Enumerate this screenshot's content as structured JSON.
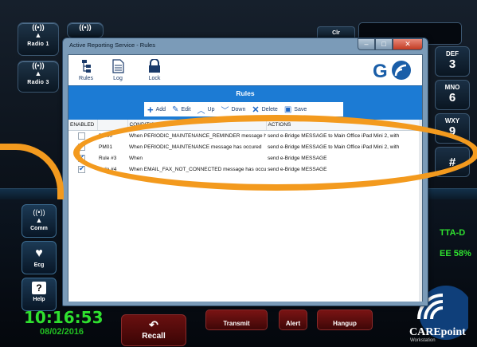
{
  "background": {
    "radio1_label": "Radio 1",
    "radio3_label": "Radio 3",
    "clr_label": "Clr",
    "keypad": [
      {
        "letters": "DEF",
        "num": "3"
      },
      {
        "letters": "MNO",
        "num": "6"
      },
      {
        "letters": "WXY",
        "num": "9"
      },
      {
        "letters": "",
        "num": "#"
      }
    ],
    "side": {
      "comm": "Comm",
      "ecg": "Ecg",
      "help": "Help"
    },
    "clock": "10:16:53",
    "date": "08/02/2016",
    "recall": "Recall",
    "transmit": "Transmit",
    "alert": "Alert",
    "hangup": "Hangup",
    "right_status1": "TTA-D",
    "right_status2": "EE 58%",
    "brand": "CAREpoint",
    "brand_sub": "Workstation"
  },
  "dialog": {
    "title": "Active Reporting Service - Rules",
    "toolbar": {
      "rules": "Rules",
      "log": "Log",
      "lock": "Lock"
    },
    "panel_title": "Rules",
    "actions": {
      "add": "Add",
      "edit": "Edit",
      "up": "Up",
      "down": "Down",
      "delete": "Delete",
      "save": "Save"
    },
    "columns": {
      "enabled": "ENABLED",
      "name": "",
      "conditions": "CONDITIONS",
      "actions": "ACTIONS"
    },
    "rows": [
      {
        "enabled": false,
        "name": "PM00",
        "conditions": "When PERIODIC_MAINTENANCE_REMINDER message h",
        "actions": "send e-Bridge MESSAGE to Main Office iPad Mini 2, with"
      },
      {
        "enabled": false,
        "name": "PM01",
        "conditions": "When PERIODIC_MAINTENANCE message has occured",
        "actions": "send e-Bridge MESSAGE to Main Office iPad Mini 2, with"
      },
      {
        "enabled": true,
        "name": "Rule #3",
        "conditions": "When",
        "actions": "send e-Bridge MESSAGE"
      },
      {
        "enabled": true,
        "name": "Rule #4",
        "conditions": "When EMAIL_FAX_NOT_CONNECTED message has occu",
        "actions": "send e-Bridge MESSAGE"
      }
    ]
  },
  "colors": {
    "accent_blue": "#1c7bd4",
    "highlight_orange": "#f39a1e",
    "clock_green": "#2fe02f"
  }
}
